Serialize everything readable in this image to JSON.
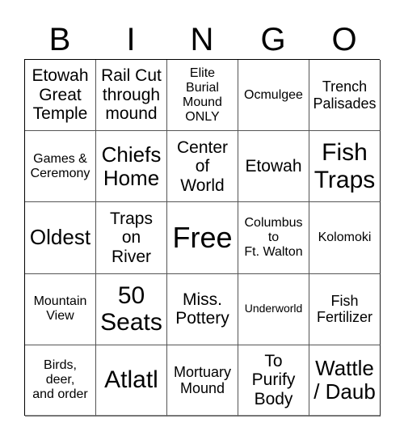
{
  "header": {
    "letters": [
      "B",
      "I",
      "N",
      "G",
      "O"
    ]
  },
  "board": {
    "rows": [
      [
        "Etowah\nGreat\nTemple",
        "Rail Cut\nthrough\nmound",
        "Elite\nBurial\nMound\nONLY",
        "Ocmulgee",
        "Trench\nPalisades"
      ],
      [
        "Games &\nCeremony",
        "Chiefs\nHome",
        "Center\nof\nWorld",
        "Etowah",
        "Fish\nTraps"
      ],
      [
        "Oldest",
        "Traps\non\nRiver",
        "Free",
        "Columbus\nto\nFt. Walton",
        "Kolomoki"
      ],
      [
        "Mountain\nView",
        "50\nSeats",
        "Miss.\nPottery",
        "Underworld",
        "Fish\nFertilizer"
      ],
      [
        "Birds,\ndeer,\nand order",
        "Atlatl",
        "Mortuary\nMound",
        "To\nPurify\nBody",
        "Wattle\n/ Daub"
      ]
    ],
    "free_space": "Free"
  }
}
